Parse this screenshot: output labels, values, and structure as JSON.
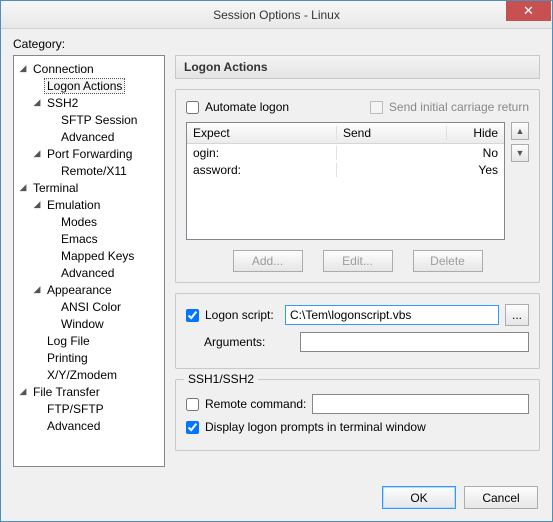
{
  "window": {
    "title": "Session Options - Linux",
    "close_glyph": "✕"
  },
  "category_label": "Category:",
  "tree": {
    "connection": "Connection",
    "logon_actions": "Logon Actions",
    "ssh2": "SSH2",
    "sftp_session": "SFTP Session",
    "advanced1": "Advanced",
    "port_forwarding": "Port Forwarding",
    "remote_x11": "Remote/X11",
    "terminal": "Terminal",
    "emulation": "Emulation",
    "modes": "Modes",
    "emacs": "Emacs",
    "mapped_keys": "Mapped Keys",
    "advanced2": "Advanced",
    "appearance": "Appearance",
    "ansi_color": "ANSI Color",
    "window": "Window",
    "log_file": "Log File",
    "printing": "Printing",
    "xyzmodem": "X/Y/Zmodem",
    "file_transfer": "File Transfer",
    "ftp_sftp": "FTP/SFTP",
    "advanced3": "Advanced"
  },
  "section": {
    "title": "Logon Actions"
  },
  "logon": {
    "automate_label": "Automate logon",
    "send_initial_label": "Send initial carriage return",
    "col_expect": "Expect",
    "col_send": "Send",
    "col_hide": "Hide",
    "rows": [
      {
        "expect": "ogin:",
        "send": "",
        "hide": "No"
      },
      {
        "expect": "assword:",
        "send": "",
        "hide": "Yes"
      }
    ],
    "btn_add": "Add...",
    "btn_edit": "Edit...",
    "btn_delete": "Delete"
  },
  "script": {
    "logon_script_label": "Logon script:",
    "logon_script_value": "C:\\Tem\\logonscript.vbs",
    "browse_label": "...",
    "arguments_label": "Arguments:",
    "arguments_value": ""
  },
  "ssh": {
    "legend": "SSH1/SSH2",
    "remote_command_label": "Remote command:",
    "remote_command_value": "",
    "display_prompts_label": "Display logon prompts in terminal window"
  },
  "footer": {
    "ok": "OK",
    "cancel": "Cancel"
  },
  "glyphs": {
    "expand": "◢",
    "up": "▲",
    "down": "▼"
  }
}
